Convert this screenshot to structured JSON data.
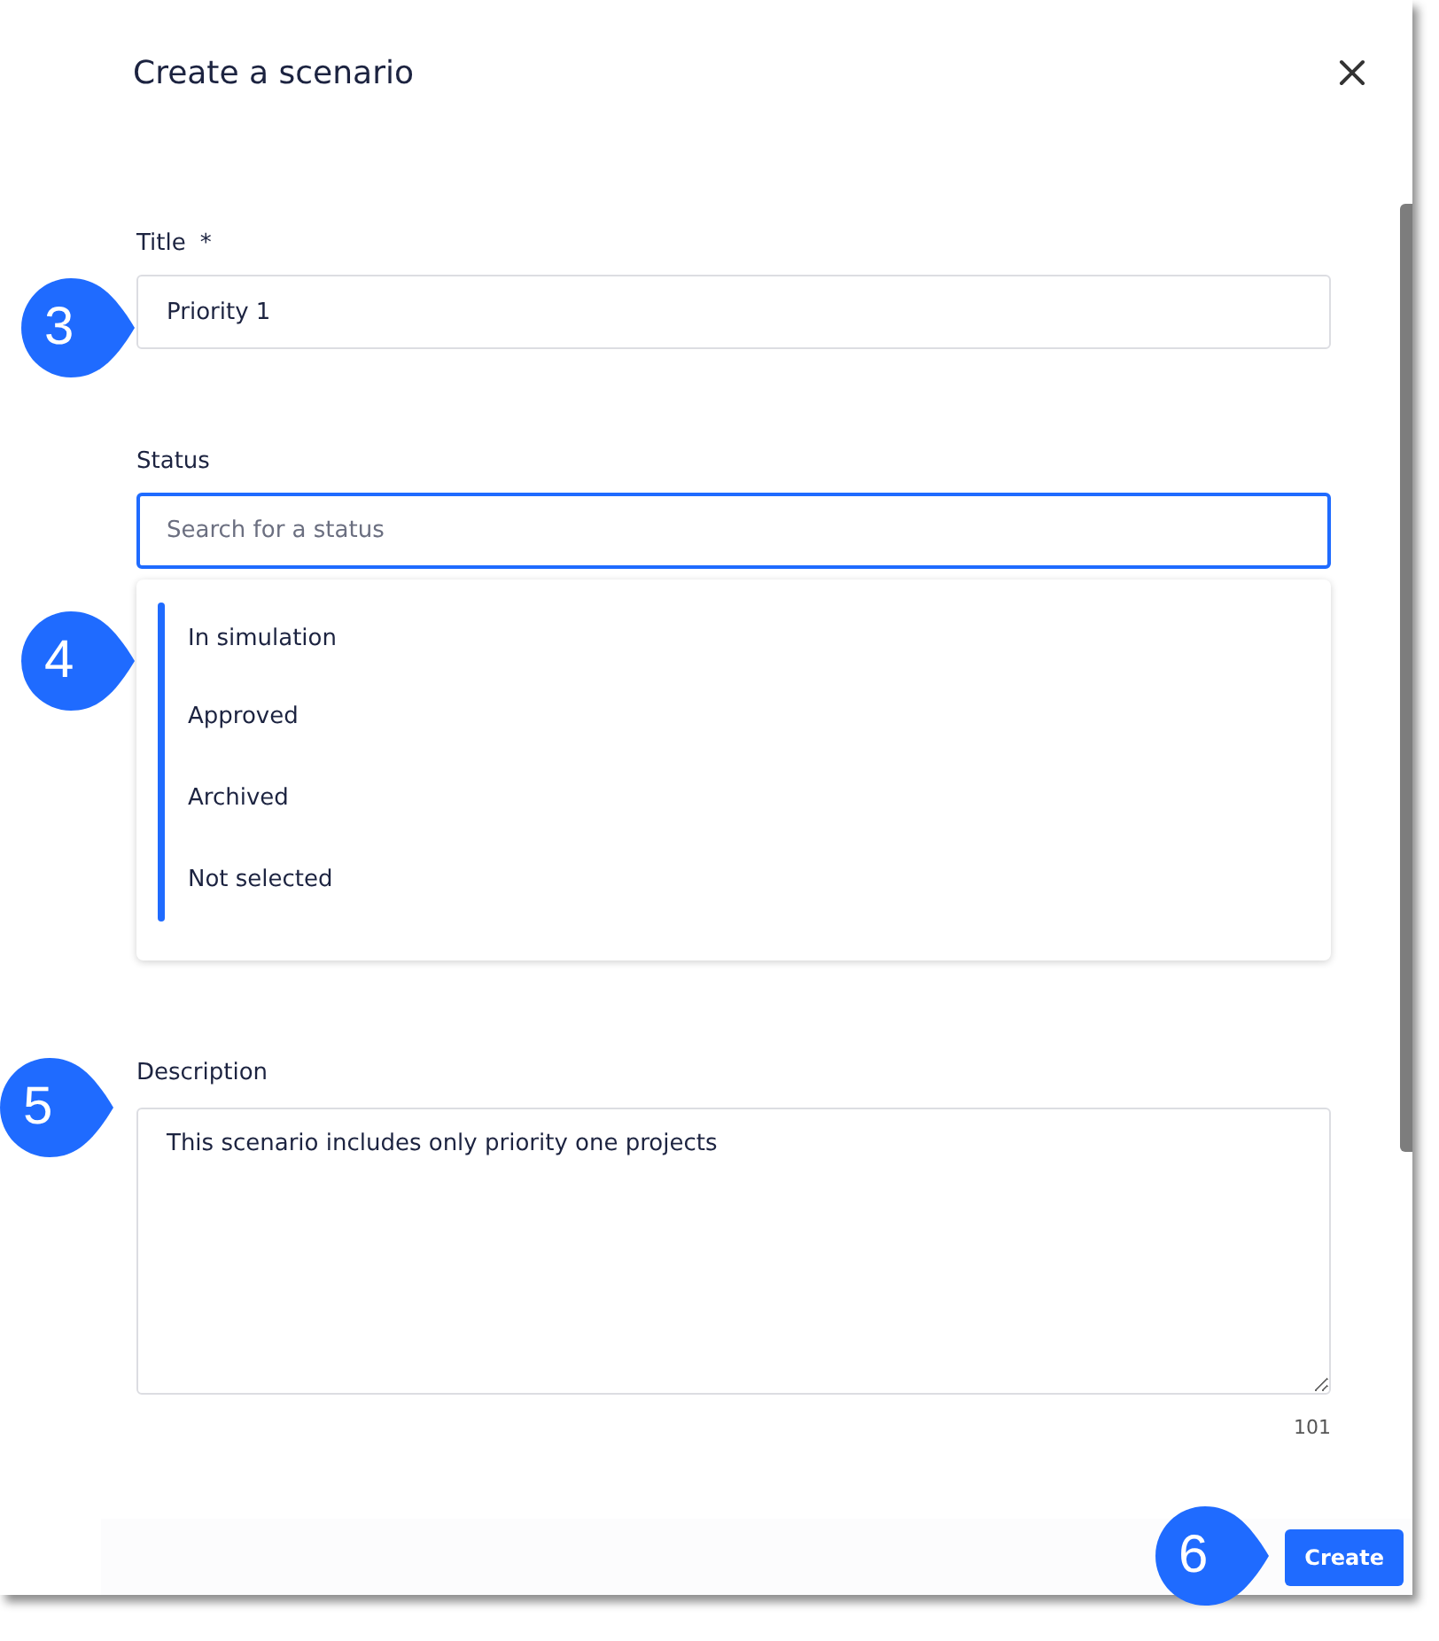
{
  "dialog": {
    "title": "Create a scenario"
  },
  "title_field": {
    "label": "Title",
    "required_mark": "*",
    "value": "Priority 1"
  },
  "status_field": {
    "label": "Status",
    "placeholder": "Search for a status",
    "options": [
      {
        "label": "In simulation"
      },
      {
        "label": "Approved"
      },
      {
        "label": "Archived"
      },
      {
        "label": "Not selected"
      }
    ]
  },
  "description_field": {
    "label": "Description",
    "value": "This scenario includes only priority one projects",
    "count": "101"
  },
  "buttons": [
    "Create"
  ],
  "callouts": [
    {
      "number": "3"
    },
    {
      "number": "4"
    },
    {
      "number": "5"
    },
    {
      "number": "6"
    }
  ]
}
